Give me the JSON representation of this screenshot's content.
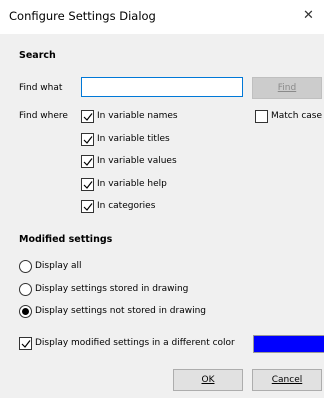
{
  "window": {
    "title": "Configure Settings Dialog",
    "close_glyph": "✕"
  },
  "search": {
    "heading": "Search",
    "find_what_label": "Find what",
    "find_what_value": "",
    "find_button_label": "Find",
    "find_where_label": "Find where",
    "options": [
      {
        "label": "In variable names",
        "checked": true
      },
      {
        "label": "In variable titles",
        "checked": true
      },
      {
        "label": "In variable values",
        "checked": true
      },
      {
        "label": "In variable help",
        "checked": true
      },
      {
        "label": "In categories",
        "checked": true
      }
    ],
    "match_case": {
      "label": "Match case",
      "checked": false
    }
  },
  "modified": {
    "heading": "Modified settings",
    "radios": [
      {
        "label": "Display all",
        "selected": false
      },
      {
        "label": "Display settings stored in drawing",
        "selected": false
      },
      {
        "label": "Display settings not stored in drawing",
        "selected": true
      }
    ],
    "diff_color": {
      "label": "Display modified settings in a different color",
      "checked": true,
      "color": "#0000ff"
    }
  },
  "footer": {
    "ok_label": "OK",
    "cancel_label": "Cancel"
  },
  "colors": {
    "accent_border": "#0078d7",
    "dialog_bg": "#f0f0f0",
    "title_bg": "#ffffff"
  }
}
